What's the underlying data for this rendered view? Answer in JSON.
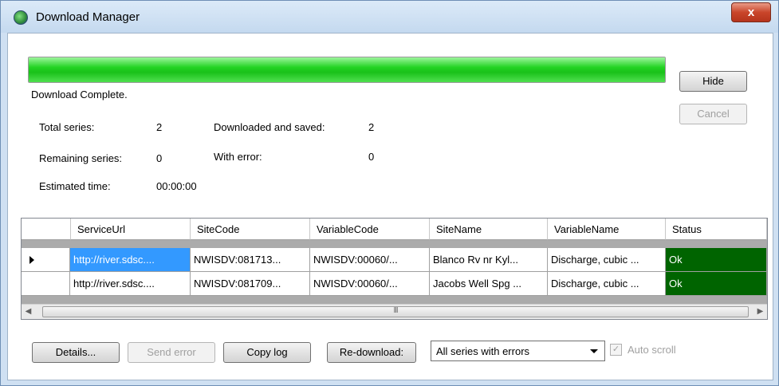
{
  "window": {
    "title": "Download Manager",
    "close_label": "x"
  },
  "progress": {
    "fraction": 1.0,
    "status": "Download Complete."
  },
  "buttons": {
    "hide": "Hide",
    "cancel": "Cancel",
    "details": "Details...",
    "send_error": "Send error",
    "copy_log": "Copy log",
    "redownload": "Re-download:"
  },
  "stats": {
    "total_series_label": "Total series:",
    "total_series_value": "2",
    "remaining_label": "Remaining series:",
    "remaining_value": "0",
    "estimated_label": "Estimated time:",
    "estimated_value": "00:00:00",
    "downloaded_label": "Downloaded and saved:",
    "downloaded_value": "2",
    "error_label": "With error:",
    "error_value": "0"
  },
  "grid": {
    "columns": [
      "ServiceUrl",
      "SiteCode",
      "VariableCode",
      "SiteName",
      "VariableName",
      "Status"
    ],
    "rows": [
      [
        "http://river.sdsc....",
        "NWISDV:081713...",
        "NWISDV:00060/...",
        "Blanco Rv nr Kyl...",
        "Discharge, cubic ...",
        "Ok"
      ],
      [
        "http://river.sdsc....",
        "NWISDV:081709...",
        "NWISDV:00060/...",
        "Jacobs Well Spg ...",
        "Discharge, cubic ...",
        "Ok"
      ]
    ],
    "scroll_grip": "III"
  },
  "redownload_select": {
    "value": "All series with errors"
  },
  "auto_scroll": {
    "label": "Auto scroll",
    "checked": true,
    "enabled": false
  },
  "colors": {
    "progress": "#23d323",
    "status_ok": "#006400",
    "selection": "#3399ff"
  }
}
